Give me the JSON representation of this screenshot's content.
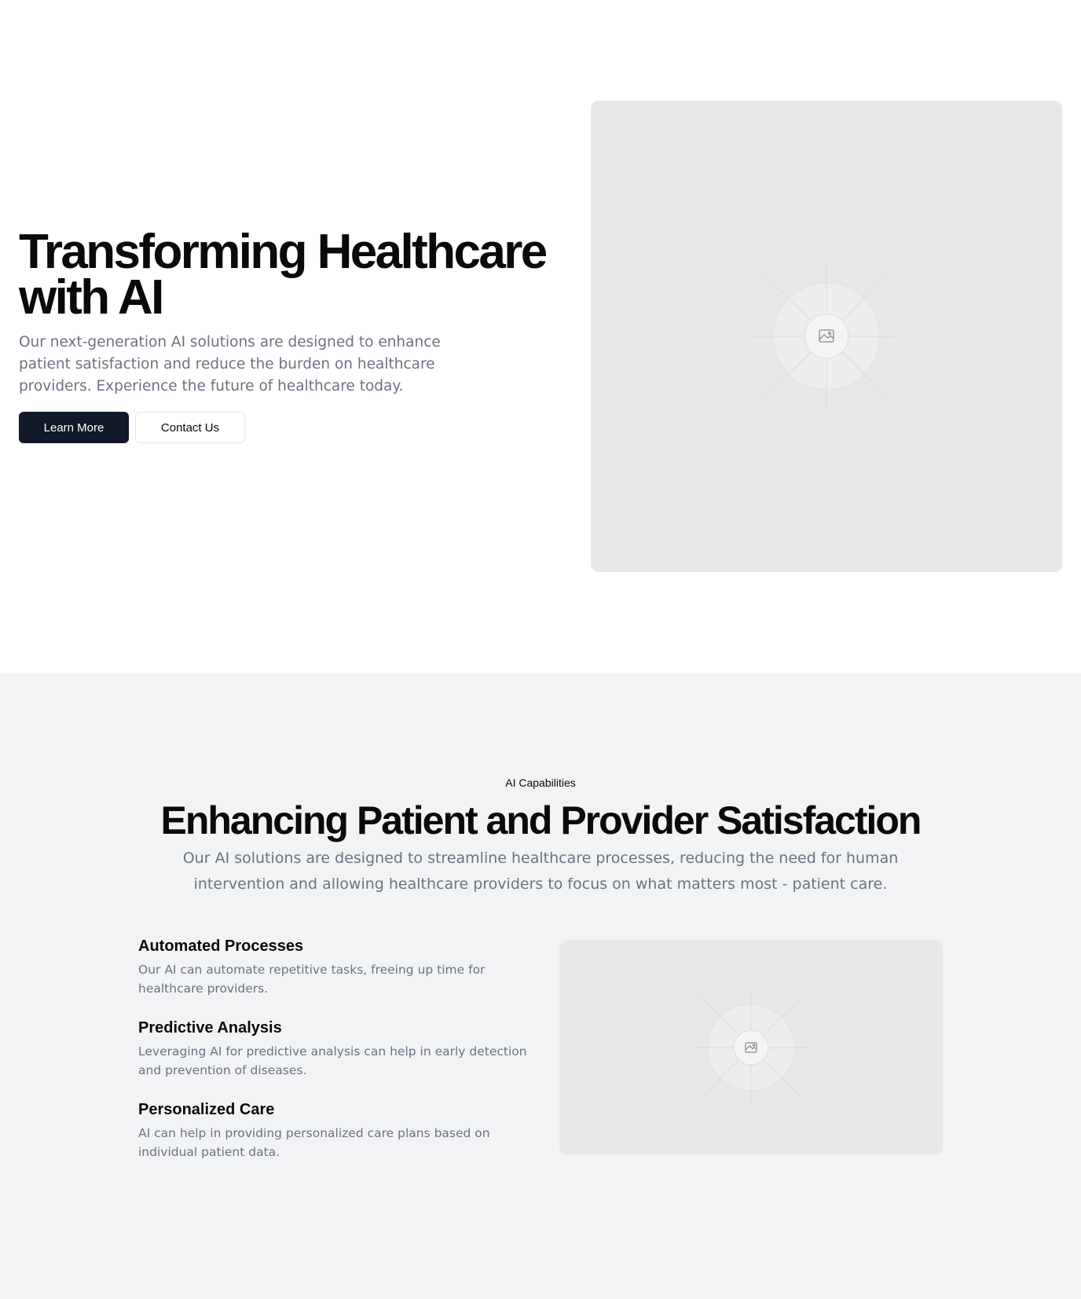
{
  "hero": {
    "title_line1": "Transforming Healthcare",
    "title_line2": "with AI",
    "subtitle": "Our next-generation AI solutions are designed to enhance patient satisfaction and reduce the burden on healthcare providers. Experience the future of healthcare today.",
    "primary_button": "Learn More",
    "secondary_button": "Contact Us",
    "image_icon": "image-placeholder-icon"
  },
  "features": {
    "eyebrow": "AI Capabilities",
    "title": "Enhancing Patient and Provider Satisfaction",
    "subtitle": "Our AI solutions are designed to streamline healthcare processes, reducing the need for human intervention and allowing healthcare providers to focus on what matters most - patient care.",
    "items": [
      {
        "title": "Automated Processes",
        "description": "Our AI can automate repetitive tasks, freeing up time for healthcare providers."
      },
      {
        "title": "Predictive Analysis",
        "description": "Leveraging AI for predictive analysis can help in early detection and prevention of diseases."
      },
      {
        "title": "Personalized Care",
        "description": "AI can help in providing personalized care plans based on individual patient data."
      }
    ],
    "image_icon": "image-placeholder-icon"
  },
  "colors": {
    "primary_button_bg": "#111827",
    "placeholder_bg": "#e8e8e8",
    "section_bg": "#f2f3f5",
    "muted_text": "#6b7280"
  }
}
